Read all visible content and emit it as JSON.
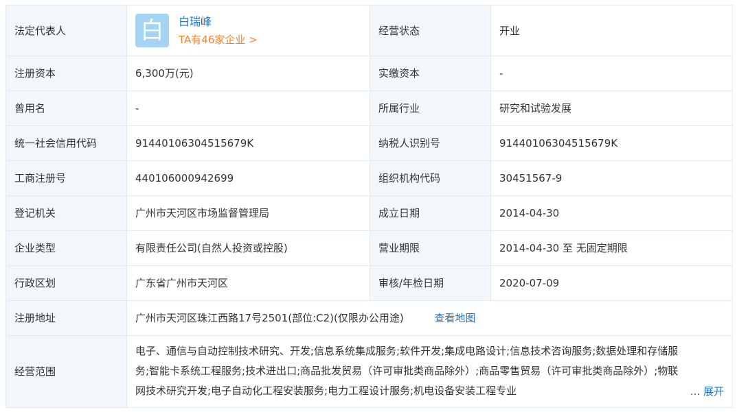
{
  "legal_rep": {
    "label": "法定代表人",
    "avatar_char": "白",
    "name": "白瑞峰",
    "companies_link": "TA有46家企业 >"
  },
  "status": {
    "label": "经营状态",
    "value": "开业"
  },
  "rows": [
    {
      "l1": "注册资本",
      "v1": "6,300万(元)",
      "l2": "实缴资本",
      "v2": "-"
    },
    {
      "l1": "曾用名",
      "v1": "-",
      "l2": "所属行业",
      "v2": "研究和试验发展"
    },
    {
      "l1": "统一社会信用代码",
      "v1": "91440106304515679K",
      "l2": "纳税人识别号",
      "v2": "91440106304515679K"
    },
    {
      "l1": "工商注册号",
      "v1": "440106000942699",
      "l2": "组织机构代码",
      "v2": "30451567-9"
    },
    {
      "l1": "登记机关",
      "v1": "广州市天河区市场监督管理局",
      "l2": "成立日期",
      "v2": "2014-04-30"
    },
    {
      "l1": "企业类型",
      "v1": "有限责任公司(自然人投资或控股)",
      "l2": "营业期限",
      "v2": "2014-04-30 至 无固定期限"
    },
    {
      "l1": "行政区划",
      "v1": "广东省广州市天河区",
      "l2": "审核/年检日期",
      "v2": "2020-07-09"
    }
  ],
  "address": {
    "label": "注册地址",
    "value": "广州市天河区珠江西路17号2501(部位:C2)(仅限办公用途)",
    "map_link": "查看地图"
  },
  "scope": {
    "label": "经营范围",
    "value": "电子、通信与自动控制技术研究、开发;信息系统集成服务;软件开发;集成电路设计;信息技术咨询服务;数据处理和存储服务;智能卡系统工程服务;技术进出口;商品批发贸易（许可审批类商品除外）;商品零售贸易（许可审批类商品除外）;物联网技术研究开发;电子自动化工程安装服务;电力工程设计服务;机电设备安装工程专业",
    "ellipsis": "...",
    "expand_link": "展开"
  }
}
